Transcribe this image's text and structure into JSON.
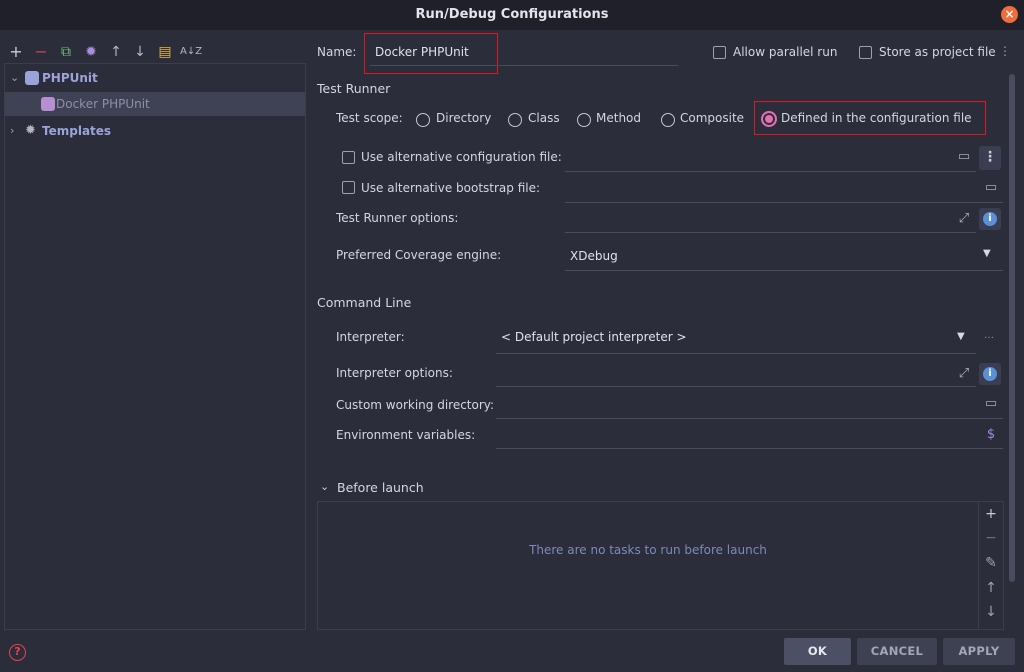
{
  "window": {
    "title": "Run/Debug Configurations"
  },
  "toolbar": {
    "icons": [
      "plus-icon",
      "minus-icon",
      "copy-icon",
      "gear-icon",
      "arrow-up-icon",
      "arrow-down-icon",
      "folder-icon",
      "sort-az-icon"
    ],
    "glyphs": [
      "+",
      "−",
      "⧉",
      "✹",
      "↑",
      "↓",
      "▤",
      "ᴬᴢ"
    ]
  },
  "tree": {
    "root_label": "PHPUnit",
    "child_label": "Docker PHPUnit",
    "templates_label": "Templates"
  },
  "header": {
    "name_label": "Name:",
    "name_value": "Docker PHPUnit",
    "allow_parallel_label": "Allow parallel run",
    "store_project_label": "Store as project file"
  },
  "test_runner": {
    "section_title": "Test Runner",
    "scope_label": "Test scope:",
    "scopes": [
      "Directory",
      "Class",
      "Method",
      "Composite",
      "Defined in the configuration file"
    ],
    "selected_scope": "Defined in the configuration file",
    "alt_config_label": "Use alternative configuration file:",
    "alt_bootstrap_label": "Use alternative bootstrap file:",
    "runner_options_label": "Test Runner options:",
    "coverage_label": "Preferred Coverage engine:",
    "coverage_value": "XDebug"
  },
  "command_line": {
    "section_title": "Command Line",
    "interpreter_label": "Interpreter:",
    "interpreter_value": "< Default project interpreter >",
    "interpreter_options_label": "Interpreter options:",
    "working_dir_label": "Custom working directory:",
    "env_vars_label": "Environment variables:",
    "env_symbol": "$"
  },
  "before_launch": {
    "title": "Before launch",
    "empty_text": "There are no tasks to run before launch"
  },
  "buttons": {
    "ok": "OK",
    "cancel": "CANCEL",
    "apply": "APPLY"
  },
  "colors": {
    "accent": "#e26fae",
    "highlight_border": "#e0171f",
    "background": "#2b2d3a"
  }
}
